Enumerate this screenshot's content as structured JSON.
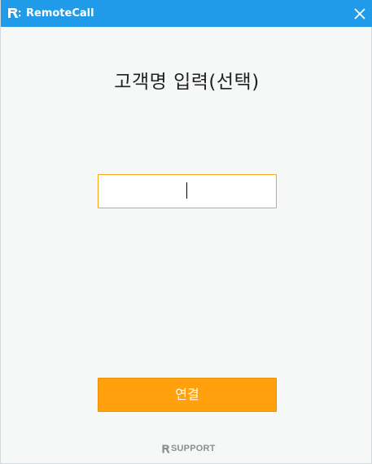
{
  "window": {
    "title": "RemoteCall",
    "icons": {
      "app": "remotecall-logo-icon",
      "close": "close-icon"
    }
  },
  "main": {
    "heading": "고객명 입력(선택)",
    "name_input": {
      "value": "",
      "placeholder": ""
    },
    "connect_label": "연결"
  },
  "footer": {
    "brand": "SUPPORT",
    "brand_icon": "rsupport-logo-icon"
  },
  "colors": {
    "titlebar": "#1f9bea",
    "accent": "#ffa00c",
    "input_border": "#f5a41c",
    "background": "#f6f8f8"
  }
}
